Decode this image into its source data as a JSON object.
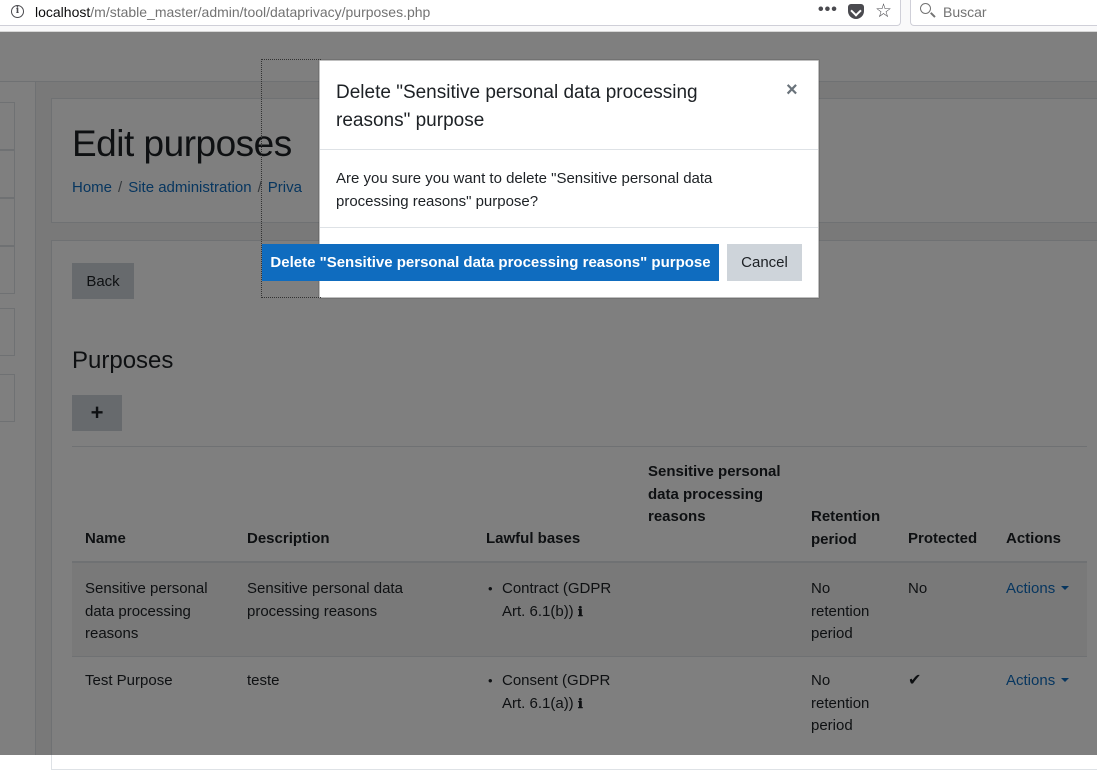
{
  "browser": {
    "url_host": "localhost",
    "url_path": "/m/stable_master/admin/tool/dataprivacy/purposes.php",
    "more_glyph": "•••",
    "search_placeholder": "Buscar"
  },
  "page": {
    "title": "Edit purposes",
    "breadcrumb": [
      "Home",
      "Site administration",
      "Priva"
    ],
    "back_label": "Back",
    "section_title": "Purposes",
    "add_label": "+",
    "table": {
      "headers": {
        "name": "Name",
        "description": "Description",
        "lawful_bases": "Lawful bases",
        "sensitive": "Sensitive personal data processing reasons",
        "retention": "Retention period",
        "protected": "Protected",
        "actions": "Actions"
      },
      "rows": [
        {
          "name": "Sensitive personal data processing reasons",
          "description": "Sensitive personal data processing reasons",
          "lawful_basis": "Contract (GDPR Art. 6.1(b))",
          "sensitive": "",
          "retention": "No retention period",
          "protected": "No",
          "actions": "Actions"
        },
        {
          "name": "Test Purpose",
          "description": "teste",
          "lawful_basis": "Consent (GDPR Art. 6.1(a))",
          "sensitive": "",
          "retention": "No retention period",
          "protected": "✔",
          "actions": "Actions"
        }
      ]
    }
  },
  "modal": {
    "title": "Delete \"Sensitive personal data processing reasons\" purpose",
    "close_glyph": "×",
    "body": "Are you sure you want to delete \"Sensitive personal data processing reasons\" purpose?",
    "confirm_label": "Delete \"Sensitive personal data processing reasons\" purpose",
    "cancel_label": "Cancel"
  },
  "colors": {
    "primary": "#0f6cbf",
    "secondary_button": "#ced4da",
    "backdrop": "rgba(0,0,0,0.5)"
  },
  "icons": [
    "info-icon",
    "pocket-icon",
    "bookmark-star-icon",
    "search-icon",
    "add-icon",
    "info-i-icon",
    "caret-down-icon",
    "checkmark-icon",
    "close-icon"
  ]
}
